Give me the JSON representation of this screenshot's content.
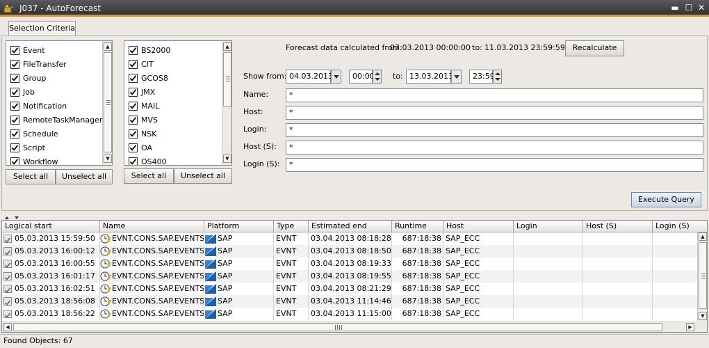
{
  "window": {
    "title": "J037 - AutoForecast",
    "minimize": "▬",
    "maximize": "☐",
    "close": "✕"
  },
  "tabs": [
    {
      "label": "Selection Criteria"
    }
  ],
  "object_types": {
    "items": [
      {
        "label": "Event",
        "checked": true
      },
      {
        "label": "FileTransfer",
        "checked": true
      },
      {
        "label": "Group",
        "checked": true
      },
      {
        "label": "Job",
        "checked": true
      },
      {
        "label": "Notification",
        "checked": true
      },
      {
        "label": "RemoteTaskManager",
        "checked": true
      },
      {
        "label": "Schedule",
        "checked": true
      },
      {
        "label": "Script",
        "checked": true
      },
      {
        "label": "Workflow",
        "checked": true
      }
    ],
    "select_all": "Select all",
    "unselect_all": "Unselect all"
  },
  "platforms": {
    "items": [
      {
        "label": "BS2000",
        "checked": true
      },
      {
        "label": "CIT",
        "checked": true
      },
      {
        "label": "GCOS8",
        "checked": true
      },
      {
        "label": "JMX",
        "checked": true
      },
      {
        "label": "MAIL",
        "checked": true
      },
      {
        "label": "MVS",
        "checked": true
      },
      {
        "label": "NSK",
        "checked": true
      },
      {
        "label": "OA",
        "checked": true
      },
      {
        "label": "OS400",
        "checked": true
      }
    ],
    "select_all": "Select all",
    "unselect_all": "Unselect all"
  },
  "forecast": {
    "calculated_from_label": "Forecast data calculated from:",
    "calculated_from": "07.03.2013 00:00:00",
    "to_label": "to:",
    "calculated_to": "11.03.2013 23:59:59",
    "recalculate": "Recalculate"
  },
  "filters": {
    "show_from_label": "Show from:",
    "from_date": "04.03.2013",
    "from_time": "00:00",
    "to_label": "to:",
    "to_date": "13.03.2013",
    "to_time": "23:59",
    "name_label": "Name:",
    "name": "*",
    "host_label": "Host:",
    "host": "*",
    "login_label": "Login:",
    "login": "*",
    "host_s_label": "Host (S):",
    "host_s": "*",
    "login_s_label": "Login (S):",
    "login_s": "*",
    "execute": "Execute Query"
  },
  "table": {
    "columns": [
      "Logical start",
      "Name",
      "Platform",
      "Type",
      "Estimated end",
      "Runtime",
      "Host",
      "Login",
      "Host (S)",
      "Login (S)"
    ],
    "rows": [
      [
        "05.03.2013 15:59:50",
        "EVNT.CONS.SAP.EVENTS",
        "SAP",
        "EVNT",
        "03.04.2013 08:18:28",
        "687:18:38",
        "SAP_ECC",
        "",
        "",
        ""
      ],
      [
        "05.03.2013 16:00:12",
        "EVNT.CONS.SAP.EVENTS",
        "SAP",
        "EVNT",
        "03.04.2013 08:18:50",
        "687:18:38",
        "SAP_ECC",
        "",
        "",
        ""
      ],
      [
        "05.03.2013 16:00:55",
        "EVNT.CONS.SAP.EVENTS",
        "SAP",
        "EVNT",
        "03.04.2013 08:19:33",
        "687:18:38",
        "SAP_ECC",
        "",
        "",
        ""
      ],
      [
        "05.03.2013 16:01:17",
        "EVNT.CONS.SAP.EVENTS",
        "SAP",
        "EVNT",
        "03.04.2013 08:19:55",
        "687:18:38",
        "SAP_ECC",
        "",
        "",
        ""
      ],
      [
        "05.03.2013 16:02:51",
        "EVNT.CONS.SAP.EVENTS",
        "SAP",
        "EVNT",
        "03.04.2013 08:21:29",
        "687:18:38",
        "SAP_ECC",
        "",
        "",
        ""
      ],
      [
        "05.03.2013 18:56:08",
        "EVNT.CONS.SAP.EVENTS",
        "SAP",
        "EVNT",
        "03.04.2013 11:14:46",
        "687:18:38",
        "SAP_ECC",
        "",
        "",
        ""
      ],
      [
        "05.03.2013 18:56:22",
        "EVNT.CONS.SAP.EVENTS",
        "SAP",
        "EVNT",
        "03.04.2013 11:15:00",
        "687:18:38",
        "SAP_ECC",
        "",
        "",
        ""
      ]
    ]
  },
  "status": {
    "found_label": "Found Objects:",
    "found_count": "67"
  },
  "colors": {
    "title_bar": "#2c2c2c",
    "title_accent": "#f08a10",
    "platform_icon": "#1f5fa8",
    "event_icon": "#e0b020"
  }
}
